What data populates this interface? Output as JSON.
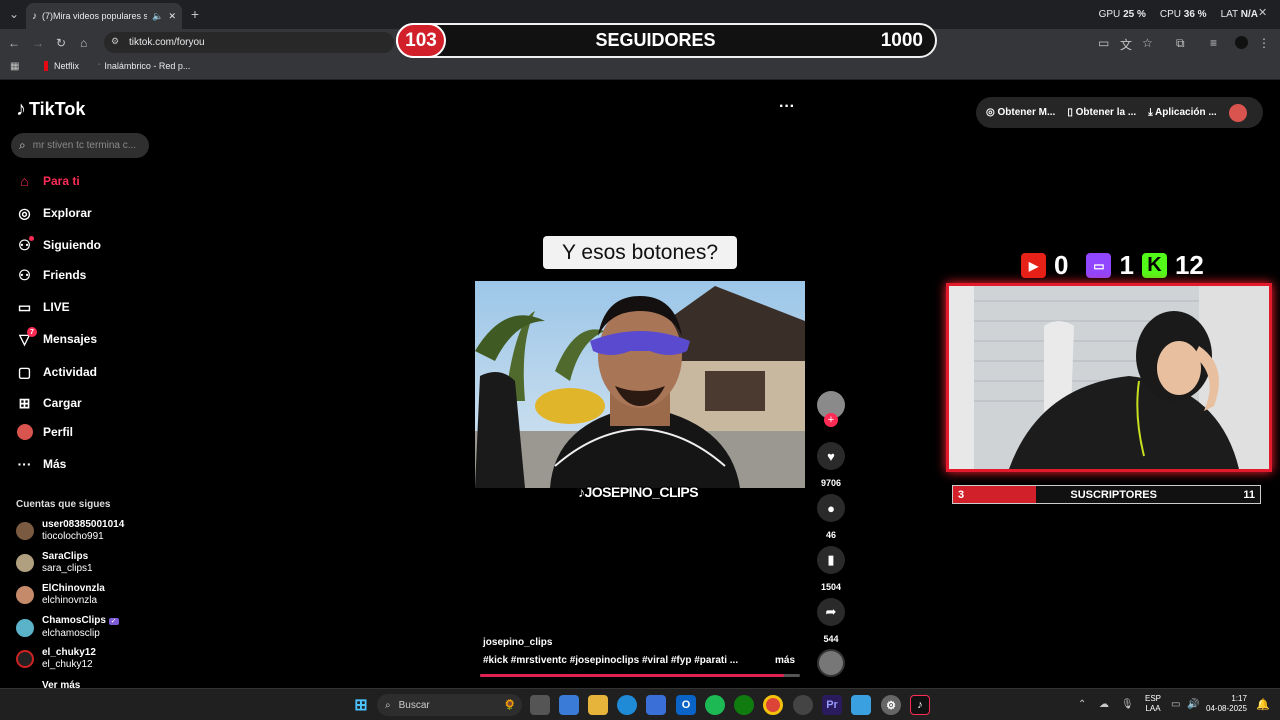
{
  "browser": {
    "tab_title": "(7)Mira videos populares s",
    "url": "tiktok.com/foryou",
    "bookmarks": [
      "Netflix",
      "Inalámbrico - Red p..."
    ]
  },
  "stats": {
    "gpu_label": "GPU",
    "gpu": "25 %",
    "cpu_label": "CPU",
    "cpu": "36 %",
    "lat_label": "LAT",
    "lat": "N/A"
  },
  "followers": {
    "count": "103",
    "label": "SEGUIDORES",
    "goal": "1000"
  },
  "sidebar": {
    "logo": "TikTok",
    "search_placeholder": "mr stiven tc termina c...",
    "nav": [
      {
        "label": "Para ti",
        "icon": "home-icon"
      },
      {
        "label": "Explorar",
        "icon": "compass-icon"
      },
      {
        "label": "Siguiendo",
        "icon": "following-icon"
      },
      {
        "label": "Friends",
        "icon": "friends-icon"
      },
      {
        "label": "LIVE",
        "icon": "live-icon"
      },
      {
        "label": "Mensajes",
        "icon": "messages-icon",
        "badge": "7"
      },
      {
        "label": "Actividad",
        "icon": "activity-icon"
      },
      {
        "label": "Cargar",
        "icon": "upload-icon"
      },
      {
        "label": "Perfil",
        "icon": "profile-icon"
      },
      {
        "label": "Más",
        "icon": "more-icon"
      }
    ],
    "following_title": "Cuentas que sigues",
    "accounts": [
      {
        "name": "user08385001014",
        "handle": "tiocolocho991"
      },
      {
        "name": "SaraClips",
        "handle": "sara_clips1"
      },
      {
        "name": "ElChinovnzla",
        "handle": "elchinovnzla"
      },
      {
        "name": "ChamosClips",
        "handle": "elchamosclip"
      },
      {
        "name": "el_chuky12",
        "handle": "el_chuky12"
      }
    ],
    "see_more": "Ver más"
  },
  "video": {
    "caption": "Y esos botones?",
    "watermark": "JOSEPINO_CLIPS",
    "author": "josepino_clips",
    "tags": "#kick #mrstiventc #josepinoclips #viral #fyp #parati ...",
    "more": "más",
    "progress": 0.95,
    "likes": "9706",
    "comments": "46",
    "saves": "1504",
    "shares": "544"
  },
  "topbar": {
    "btn1": "Obtener M...",
    "btn2": "Obtener la ...",
    "btn3": "Aplicación ..."
  },
  "social": {
    "youtube": "0",
    "twitch": "1",
    "kick": "12"
  },
  "subs": {
    "count": "3",
    "label": "SUSCRIPTORES",
    "goal": "11",
    "fraction": 0.27
  },
  "taskbar": {
    "search": "Buscar",
    "lang1": "ESP",
    "lang2": "LAA",
    "time": "1:17",
    "date": "04-08-2025"
  }
}
